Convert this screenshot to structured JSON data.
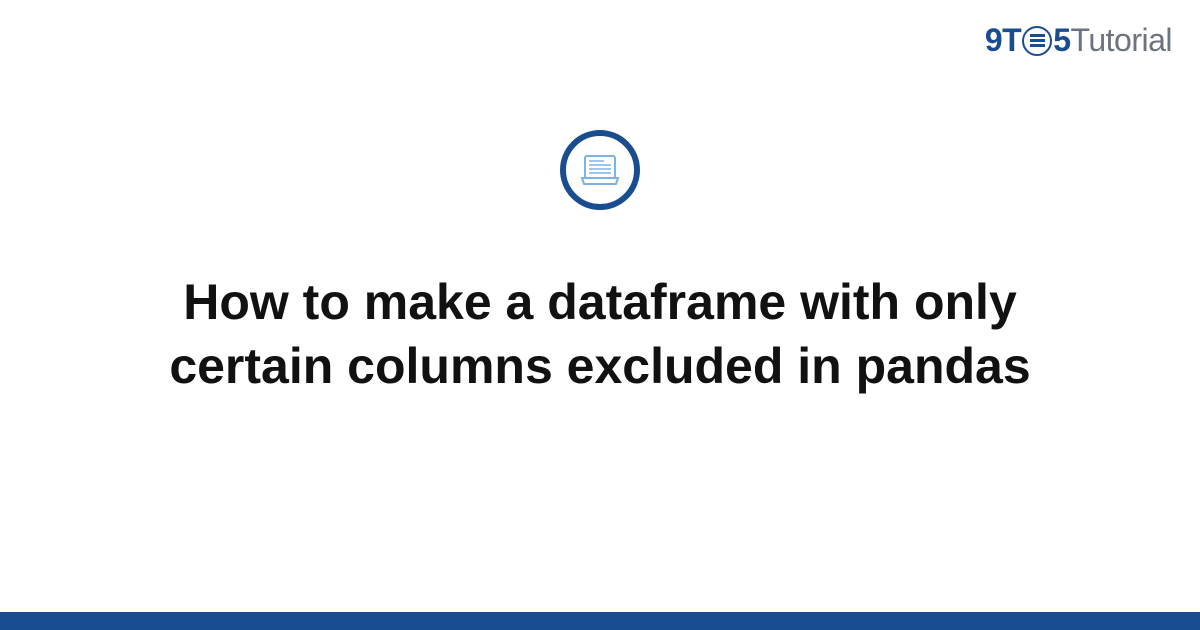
{
  "logo": {
    "nine": "9",
    "t": "T",
    "five": "5",
    "tutorial": "Tutorial"
  },
  "title": "How to make a dataframe with only certain columns excluded in pandas",
  "colors": {
    "primary": "#1a4d8f",
    "text": "#111111",
    "muted": "#6b7280"
  }
}
